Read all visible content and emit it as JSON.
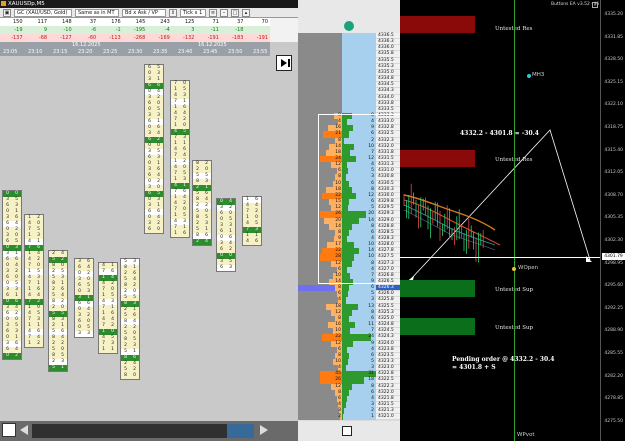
{
  "footprint": {
    "title": "XAUUSDp,M5",
    "toolbar": {
      "symbol_select": "GC (XAU/USD, Gold)",
      "period_select": "Same as in MT",
      "mode_select": "Bd x Ask / VP",
      "tick_select": "Tick x 1"
    },
    "stats": {
      "total": [
        "150",
        "117",
        "148",
        "37",
        "176",
        "145",
        "243",
        "125",
        "71",
        "37",
        "70"
      ],
      "delta_pos": [
        "-19",
        "9",
        "-10",
        "-6",
        "-1",
        "-195",
        "-4",
        "3",
        "-11",
        "-18",
        ""
      ],
      "delta_neg": [
        "-137",
        "-68",
        "-127",
        "-60",
        "-113",
        "-268",
        "-169",
        "-132",
        "-191",
        "-183",
        "-191"
      ]
    },
    "dates": [
      "16.12.2025",
      "16.12.2025"
    ],
    "times": [
      "23:05",
      "23:10",
      "23:15",
      "23:20",
      "23:25",
      "23:30",
      "23:35",
      "23:40",
      "23:45",
      "23:50",
      "23:55"
    ]
  },
  "ladder": {
    "prices": [
      "4336.5",
      "4336.3",
      "4336.0",
      "4335.8",
      "4335.5",
      "4335.3",
      "4335.0",
      "4334.8",
      "4334.5",
      "4334.3",
      "4334.0",
      "4333.8",
      "4333.5",
      "4333.3",
      "4333.0",
      "4332.8",
      "4332.5",
      "4332.3",
      "4332.0",
      "4331.8",
      "4331.5",
      "4331.3",
      "4331.0",
      "4330.8",
      "4330.5",
      "4330.3",
      "4330.0",
      "4329.8",
      "4329.5",
      "4329.3",
      "4329.0",
      "4328.8",
      "4328.5",
      "4328.3",
      "4328.0",
      "4327.8",
      "4327.5",
      "4327.3",
      "4327.0",
      "4326.8",
      "4326.5",
      "4326.3",
      "4326.0",
      "4325.8",
      "4325.5",
      "4325.3",
      "4325.0",
      "4324.8",
      "4324.5",
      "4324.3",
      "4324.0",
      "4323.8",
      "4323.5",
      "4323.3",
      "4323.0",
      "4322.8",
      "4322.5",
      "4322.3",
      "4322.0",
      "4321.8",
      "4321.5",
      "4321.3",
      "4321.0"
    ],
    "bid_vol": [
      "",
      "",
      "",
      "",
      "",
      "",
      "",
      "",
      "",
      "",
      "",
      "",
      "",
      "9",
      "4",
      "16",
      "21",
      "8",
      "14",
      "18",
      "24",
      "12",
      "6",
      "8",
      "10",
      "18",
      "22",
      "15",
      "12",
      "26",
      "20",
      "14",
      "8",
      "9",
      "17",
      "22",
      "28",
      "12",
      "6",
      "10",
      "14",
      "8",
      "6",
      "4",
      "18",
      "12",
      "8",
      "16",
      "10",
      "22",
      "12",
      "6",
      "8",
      "10",
      "4",
      "45",
      "26",
      "12",
      "8",
      "6",
      "4",
      "3",
      "2"
    ],
    "ask_vol": [
      "",
      "",
      "",
      "",
      "",
      "",
      "",
      "",
      "",
      "",
      "",
      "",
      "",
      "8",
      "4",
      "9",
      "6",
      "2",
      "10",
      "7",
      "12",
      "4",
      "5",
      "3",
      "6",
      "8",
      "12",
      "6",
      "5",
      "20",
      "14",
      "8",
      "6",
      "4",
      "10",
      "14",
      "10",
      "8",
      "4",
      "7",
      "9",
      "6",
      "5",
      "3",
      "13",
      "8",
      "6",
      "11",
      "7",
      "24",
      "9",
      "4",
      "6",
      "5",
      "3",
      "31",
      "18",
      "8",
      "6",
      "4",
      "3",
      "2",
      "1"
    ]
  },
  "mt": {
    "title": "Buttons EA v3.52 - Hi",
    "zones": [
      {
        "label": "Untested Res",
        "color": "#8a0a0a"
      },
      {
        "label": "Untested Res",
        "color": "#8a0a0a"
      },
      {
        "label": "Untested Sup",
        "color": "#0a6e1a"
      },
      {
        "label": "Untested Sup",
        "color": "#0a6e1a"
      }
    ],
    "labels": {
      "mh3": "MH3",
      "wopen": "WOpen",
      "wpivot": "WPvot"
    },
    "note_top": "4332.2 - 4301.8 = -30.4",
    "note_bottom_1": "Pending order @ 4332.2 - 30.4",
    "note_bottom_2": "= 4301.8 + S",
    "current_price": "4301.79",
    "axis": [
      "4335.20",
      "4331.85",
      "4328.50",
      "4325.15",
      "4322.10",
      "4318.75",
      "4315.40",
      "4312.05",
      "4308.70",
      "4305.35",
      "4302.30",
      "4298.95",
      "4295.60",
      "4292.25",
      "4288.90",
      "4285.55",
      "4282.20",
      "4278.85",
      "4275.50"
    ]
  },
  "colors": {
    "bid": "#ff8c1a",
    "ask": "#2e9a2e",
    "pivot_line": "#2fa12f",
    "zone_res": "#8a0a0a",
    "zone_sup": "#0a6e1a"
  }
}
